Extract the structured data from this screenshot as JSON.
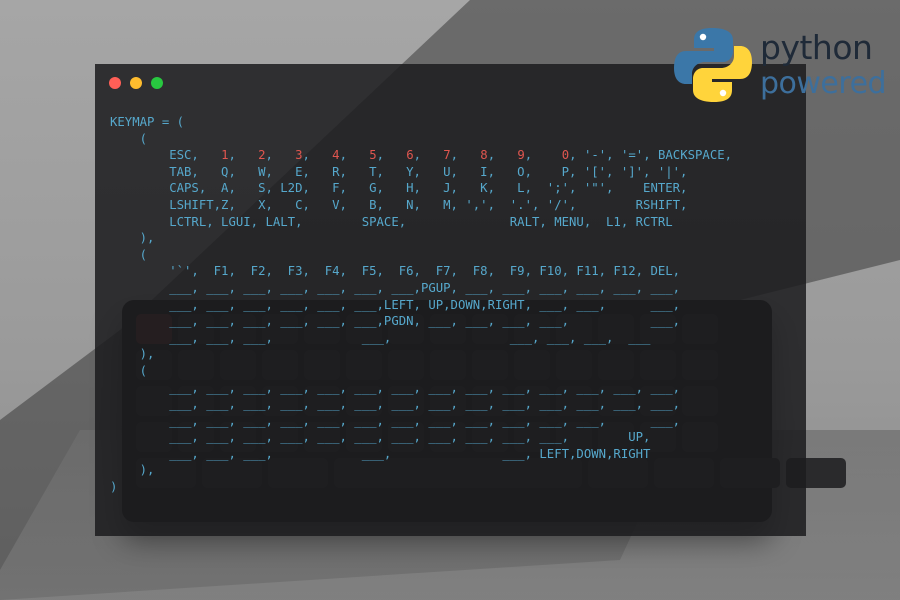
{
  "window": {
    "controls": [
      "close",
      "minimize",
      "zoom"
    ]
  },
  "logo": {
    "line1": "python",
    "line2": "powered",
    "colors": {
      "blue": "#3b77a8",
      "yellow": "#ffd43b"
    }
  },
  "code": {
    "header": "KEYMAP = (",
    "layer_open": "    (",
    "layer_close": "    ),",
    "footer": ")",
    "layers": [
      [
        [
          [
            "        ESC,   ",
            "t"
          ],
          [
            "1",
            "r"
          ],
          [
            ",   ",
            "t"
          ],
          [
            "2",
            "r"
          ],
          [
            ",   ",
            "t"
          ],
          [
            "3",
            "r"
          ],
          [
            ",   ",
            "t"
          ],
          [
            "4",
            "r"
          ],
          [
            ",   ",
            "t"
          ],
          [
            "5",
            "r"
          ],
          [
            ",   ",
            "t"
          ],
          [
            "6",
            "r"
          ],
          [
            ",   ",
            "t"
          ],
          [
            "7",
            "r"
          ],
          [
            ",   ",
            "t"
          ],
          [
            "8",
            "r"
          ],
          [
            ",   ",
            "t"
          ],
          [
            "9",
            "r"
          ],
          [
            ",    ",
            "t"
          ],
          [
            "0",
            "r"
          ],
          [
            ", '-', '=', BACKSPACE,",
            "t"
          ]
        ],
        [
          [
            "        TAB,   Q,   W,   E,   R,   T,   Y,   U,   I,   O,    P, '[', ']', '|',",
            "t"
          ]
        ],
        [
          [
            "        CAPS,  A,   S, L2D,   F,   G,   H,   J,   K,   L,  ';', '\"',    ENTER,",
            "t"
          ]
        ],
        [
          [
            "        LSHIFT,Z,   X,   C,   V,   B,   N,   M, ',',  '.', '/',        RSHIFT,",
            "t"
          ]
        ],
        [
          [
            "        LCTRL, LGUI, LALT,        SPACE,              RALT, MENU,  L1, RCTRL",
            "t"
          ]
        ]
      ],
      [
        [
          [
            "        '`',  F1,  F2,  F3,  F4,  F5,  F6,  F7,  F8,  F9, F10, F11, F12, DEL,",
            "t"
          ]
        ],
        [
          [
            "        ___, ___, ___, ___, ___, ___, ___,PGUP, ___, ___, ___, ___, ___, ___,",
            "t"
          ]
        ],
        [
          [
            "        ___, ___, ___, ___, ___, ___,LEFT, UP,DOWN,RIGHT, ___, ___,      ___,",
            "t"
          ]
        ],
        [
          [
            "        ___, ___, ___, ___, ___, ___,PGDN, ___, ___, ___, ___,           ___,",
            "t"
          ]
        ],
        [
          [
            "        ___, ___, ___,            ___,                ___, ___, ___,  ___",
            "t"
          ]
        ]
      ],
      [
        [
          [
            "        ___, ___, ___, ___, ___, ___, ___, ___, ___, ___, ___, ___, ___, ___,",
            "t"
          ]
        ],
        [
          [
            "        ___, ___, ___, ___, ___, ___, ___, ___, ___, ___, ___, ___, ___, ___,",
            "t"
          ]
        ],
        [
          [
            "        ___, ___, ___, ___, ___, ___, ___, ___, ___, ___, ___, ___,      ___,",
            "t"
          ]
        ],
        [
          [
            "        ___, ___, ___, ___, ___, ___, ___, ___, ___, ___, ___,        UP,",
            "t"
          ]
        ],
        [
          [
            "        ___, ___, ___,            ___,               ___, LEFT,DOWN,RIGHT",
            "t"
          ]
        ]
      ]
    ]
  }
}
